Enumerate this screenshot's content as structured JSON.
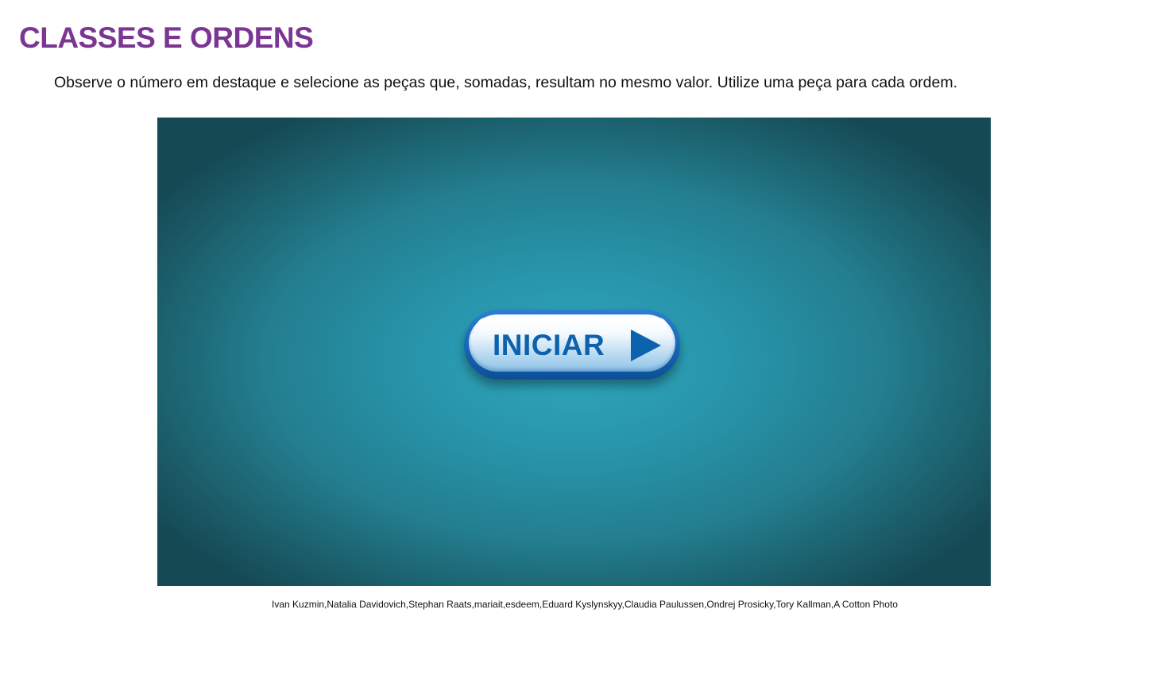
{
  "page": {
    "title": "CLASSES E ORDENS",
    "instructions": "Observe o número em destaque e selecione as peças que, somadas, resultam no mesmo valor. Utilize uma peça para cada ordem."
  },
  "activity": {
    "start_button": {
      "label": "INICIAR",
      "icon": "play-icon"
    }
  },
  "credits": "Ivan Kuzmin,Natalia Davidovich,Stephan Raats,mariait,esdeem,Eduard Kyslynskyy,Claudia Paulussen,Ondrej Prosicky,Tory Kallman,A Cotton Photo",
  "colors": {
    "title": "#7b3592",
    "stage_center": "#2ea6bd",
    "stage_edge": "#154a55",
    "button_border": "#1566b6",
    "button_text": "#0c62ad"
  }
}
